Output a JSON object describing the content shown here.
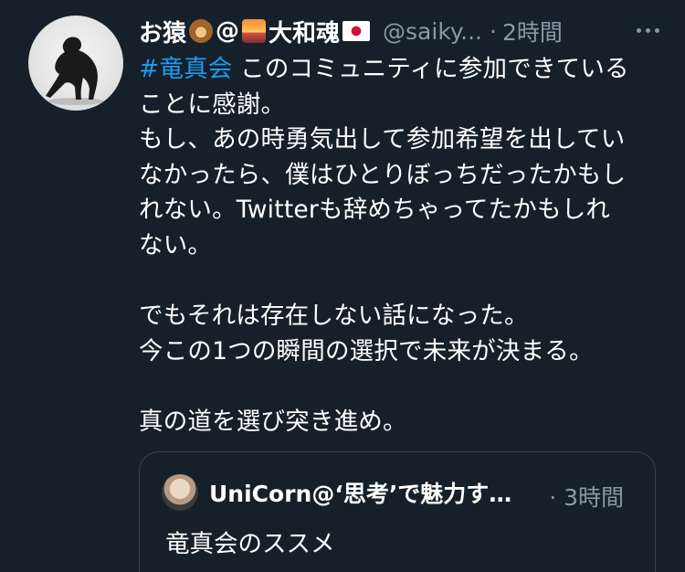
{
  "tweet": {
    "display_name_prefix": "お猿",
    "display_name_at": "@",
    "display_name_suffix": "大和魂",
    "handle": "@saiky...",
    "separator": "·",
    "time": "2時間",
    "hashtag": "#竜真会",
    "body_first_line": " このコミュニティに参加できている\nことに感謝。\nもし、あの時勇気出して参加希望を出してい\nなかったら、僕はひとりぼっちだったかもし\nれない。Twitterも辞めちゃってたかもしれ\nない。\n\nでもそれは存在しない話になった。\n今この1つの瞬間の選択で未来が決まる。\n\n真の道を選び突き進め。",
    "emojis": [
      "monkey-emoji",
      "sunrise-emoji",
      "japan-flag-emoji"
    ]
  },
  "quote": {
    "name": "UniCorn@‘思考’で魅力す…",
    "separator": "·",
    "time": "3時間",
    "text": "竜真会のススメ"
  },
  "colors": {
    "background": "#15202b",
    "text": "#ffffff",
    "secondary": "#8899a6",
    "hashtag": "#1d9bf0",
    "border": "#38444d"
  }
}
